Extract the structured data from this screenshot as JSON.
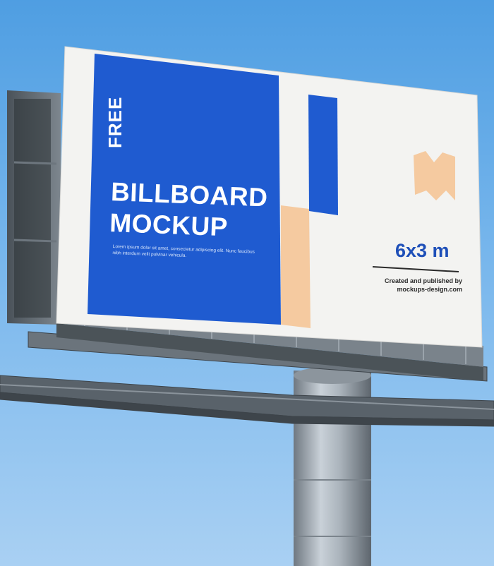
{
  "billboard": {
    "free_label": "FREE",
    "title_line1": "BILLBOARD",
    "title_line2": "MOCKUP",
    "lorem_text": "Lorem ipsum dolor sit amet, consectetur adipiscing elit. Nunc faucibus nibh interdum velit pulvinar vehicula.",
    "size_label": "6x3 m",
    "credit_line1": "Created and published by",
    "credit_line2": "mockups-design.com"
  },
  "colors": {
    "sky": "#5ea8e6",
    "blue": "#1f5bd0",
    "peach": "#f5caa0",
    "panel": "#f3f3f1",
    "steel": "#9aa3ab"
  },
  "icons": {
    "logo": "m-logo-icon"
  }
}
